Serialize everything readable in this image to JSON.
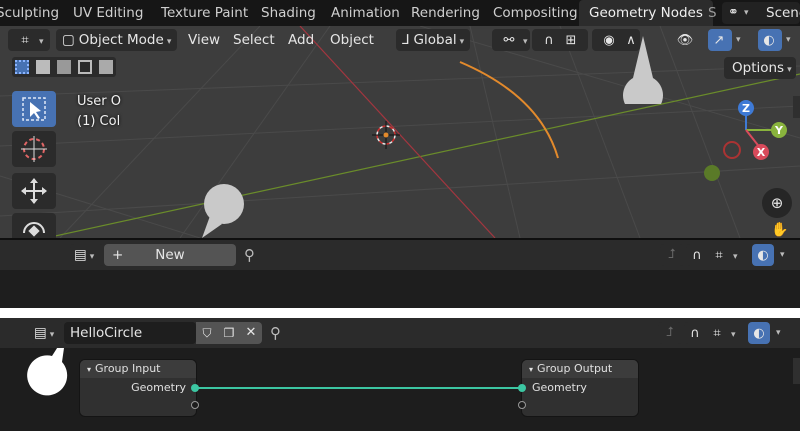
{
  "workspace_tabs": [
    "Sculpting",
    "UV Editing",
    "Texture Paint",
    "Shading",
    "Animation",
    "Rendering",
    "Compositing",
    "Geometry Nodes",
    "S"
  ],
  "active_tab": "Geometry Nodes",
  "scene_label": "Scene",
  "viewport_header": {
    "mode": "Object Mode",
    "menus": [
      "View",
      "Select",
      "Add",
      "Object"
    ],
    "orientation": "Global",
    "options": "Options"
  },
  "overlay_text": {
    "line1": "User O",
    "line2": "(1) Col"
  },
  "gizmo": {
    "z": "Z",
    "y": "Y",
    "x": "X"
  },
  "editor1": {
    "new_label": "New"
  },
  "editor2": {
    "node_group": "HelloCircle"
  },
  "nodes": {
    "group_input": {
      "title": "Group Input",
      "socket": "Geometry"
    },
    "group_output": {
      "title": "Group Output",
      "socket": "Geometry"
    }
  },
  "colors": {
    "link": "#3cc6a2",
    "selected": "#4772b3",
    "x_axis": "#a3363f",
    "y_axis": "#6a8c2a",
    "curve": "#e38a2c"
  }
}
